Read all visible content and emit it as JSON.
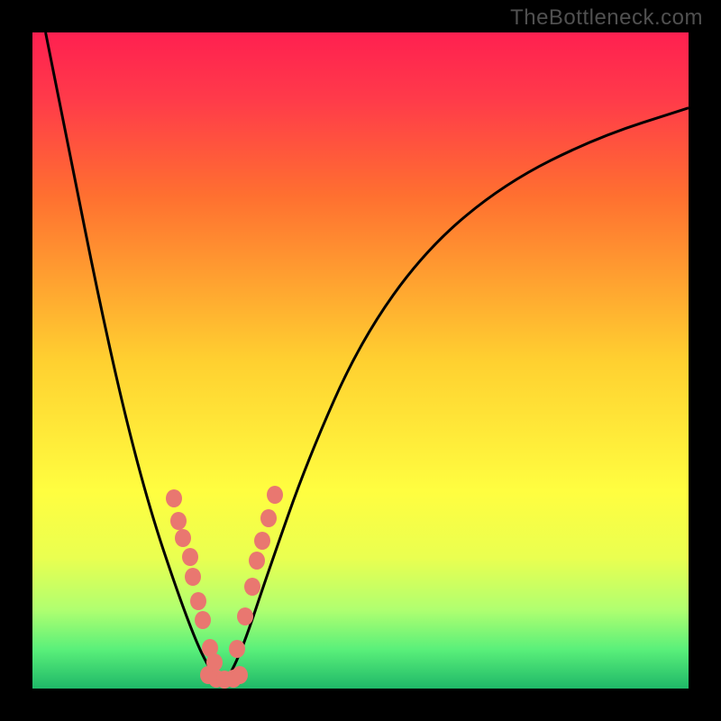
{
  "watermark": "TheBottleneck.com",
  "colors": {
    "black": "#000000",
    "watermark_text": "#505050",
    "curve": "#000000",
    "marker": "#e97770",
    "gradient_stops": [
      "#ff2050",
      "#ff4a4a",
      "#ff8030",
      "#ffb020",
      "#ffe030",
      "#f7ff3a",
      "#c8ff60",
      "#7aff7a",
      "#30e27a",
      "#18b860"
    ]
  },
  "chart_data": {
    "type": "line",
    "title": "",
    "xlabel": "",
    "ylabel": "",
    "xlim": [
      0,
      1
    ],
    "ylim": [
      0,
      1
    ],
    "series": [
      {
        "name": "left-curve",
        "x": [
          0.02,
          0.06,
          0.1,
          0.14,
          0.18,
          0.22,
          0.25,
          0.27,
          0.285
        ],
        "y": [
          1.0,
          0.8,
          0.6,
          0.42,
          0.27,
          0.15,
          0.07,
          0.03,
          0.01
        ]
      },
      {
        "name": "right-curve",
        "x": [
          0.295,
          0.32,
          0.36,
          0.42,
          0.5,
          0.6,
          0.72,
          0.86,
          1.0
        ],
        "y": [
          0.01,
          0.06,
          0.18,
          0.35,
          0.53,
          0.67,
          0.77,
          0.84,
          0.885
        ]
      }
    ],
    "markers": {
      "name": "highlighted-points",
      "color": "#e97770",
      "points": [
        {
          "x": 0.215,
          "y": 0.29
        },
        {
          "x": 0.222,
          "y": 0.255
        },
        {
          "x": 0.23,
          "y": 0.23
        },
        {
          "x": 0.24,
          "y": 0.2
        },
        {
          "x": 0.245,
          "y": 0.17
        },
        {
          "x": 0.253,
          "y": 0.133
        },
        {
          "x": 0.26,
          "y": 0.105
        },
        {
          "x": 0.27,
          "y": 0.062
        },
        {
          "x": 0.278,
          "y": 0.04
        },
        {
          "x": 0.268,
          "y": 0.02
        },
        {
          "x": 0.28,
          "y": 0.015
        },
        {
          "x": 0.293,
          "y": 0.014
        },
        {
          "x": 0.306,
          "y": 0.015
        },
        {
          "x": 0.316,
          "y": 0.02
        },
        {
          "x": 0.312,
          "y": 0.06
        },
        {
          "x": 0.324,
          "y": 0.11
        },
        {
          "x": 0.335,
          "y": 0.155
        },
        {
          "x": 0.342,
          "y": 0.195
        },
        {
          "x": 0.35,
          "y": 0.225
        },
        {
          "x": 0.36,
          "y": 0.26
        },
        {
          "x": 0.37,
          "y": 0.295
        }
      ]
    },
    "background": {
      "type": "vertical-gradient",
      "stops": [
        {
          "pos": 0.0,
          "color": "#ff2050"
        },
        {
          "pos": 0.1,
          "color": "#ff3a4a"
        },
        {
          "pos": 0.25,
          "color": "#ff7030"
        },
        {
          "pos": 0.5,
          "color": "#ffd030"
        },
        {
          "pos": 0.7,
          "color": "#fffe40"
        },
        {
          "pos": 0.8,
          "color": "#eaff50"
        },
        {
          "pos": 0.88,
          "color": "#b0ff70"
        },
        {
          "pos": 0.94,
          "color": "#5af07a"
        },
        {
          "pos": 1.0,
          "color": "#1fb868"
        }
      ]
    }
  }
}
